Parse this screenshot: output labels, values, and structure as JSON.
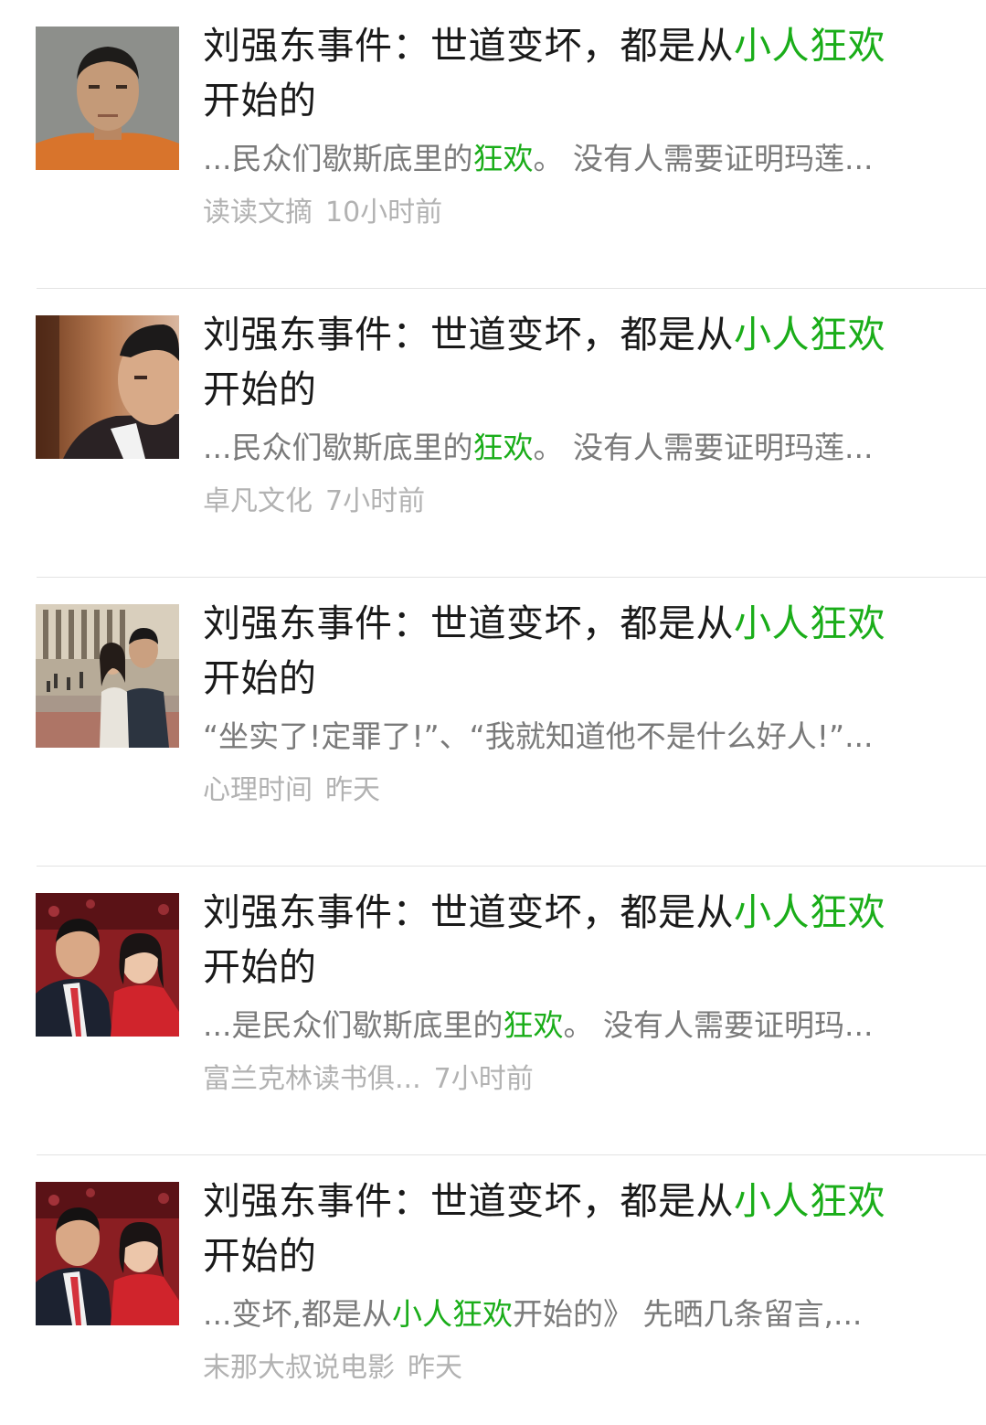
{
  "accent_color": "#1aad19",
  "results": [
    {
      "title_pre": "刘强东事件：世道变坏，都是从",
      "title_hl": "小人狂欢",
      "title_line2": "开始的",
      "snippet_pre": "...民众们歇斯底里的",
      "snippet_hl": "狂欢",
      "snippet_post": "。 没有人需要证明玛莲...",
      "source": "读读文摘",
      "time": "10小时前",
      "thumb_icon": "mugshot-photo"
    },
    {
      "title_pre": "刘强东事件：世道变坏，都是从",
      "title_hl": "小人狂欢",
      "title_line2": "开始的",
      "snippet_pre": "...民众们歇斯底里的",
      "snippet_hl": "狂欢",
      "snippet_post": "。 没有人需要证明玛莲...",
      "source": "卓凡文化",
      "time": "7小时前",
      "thumb_icon": "portrait-photo"
    },
    {
      "title_pre": "刘强东事件：世道变坏，都是从",
      "title_hl": "小人狂欢",
      "title_line2": "开始的",
      "snippet_pre": "“坐实了!定罪了!”、“我就知道他不是什么好人!”...",
      "snippet_hl": "",
      "snippet_post": "",
      "source": "心理时间",
      "time": "昨天",
      "thumb_icon": "couple-campus-photo"
    },
    {
      "title_pre": "刘强东事件：世道变坏，都是从",
      "title_hl": "小人狂欢",
      "title_line2": "开始的",
      "snippet_pre": "...是民众们歇斯底里的",
      "snippet_hl": "狂欢",
      "snippet_post": "。 没有人需要证明玛...",
      "source": "富兰克林读书俱...",
      "time": "7小时前",
      "thumb_icon": "couple-event-photo"
    },
    {
      "title_pre": "刘强东事件：世道变坏，都是从",
      "title_hl": "小人狂欢",
      "title_line2": "开始的",
      "snippet_pre": "...变坏,都是从",
      "snippet_hl": "小人狂欢",
      "snippet_post": "开始的》 先晒几条留言,...",
      "source": "末那大叔说电影",
      "time": "昨天",
      "thumb_icon": "couple-event-photo"
    }
  ]
}
